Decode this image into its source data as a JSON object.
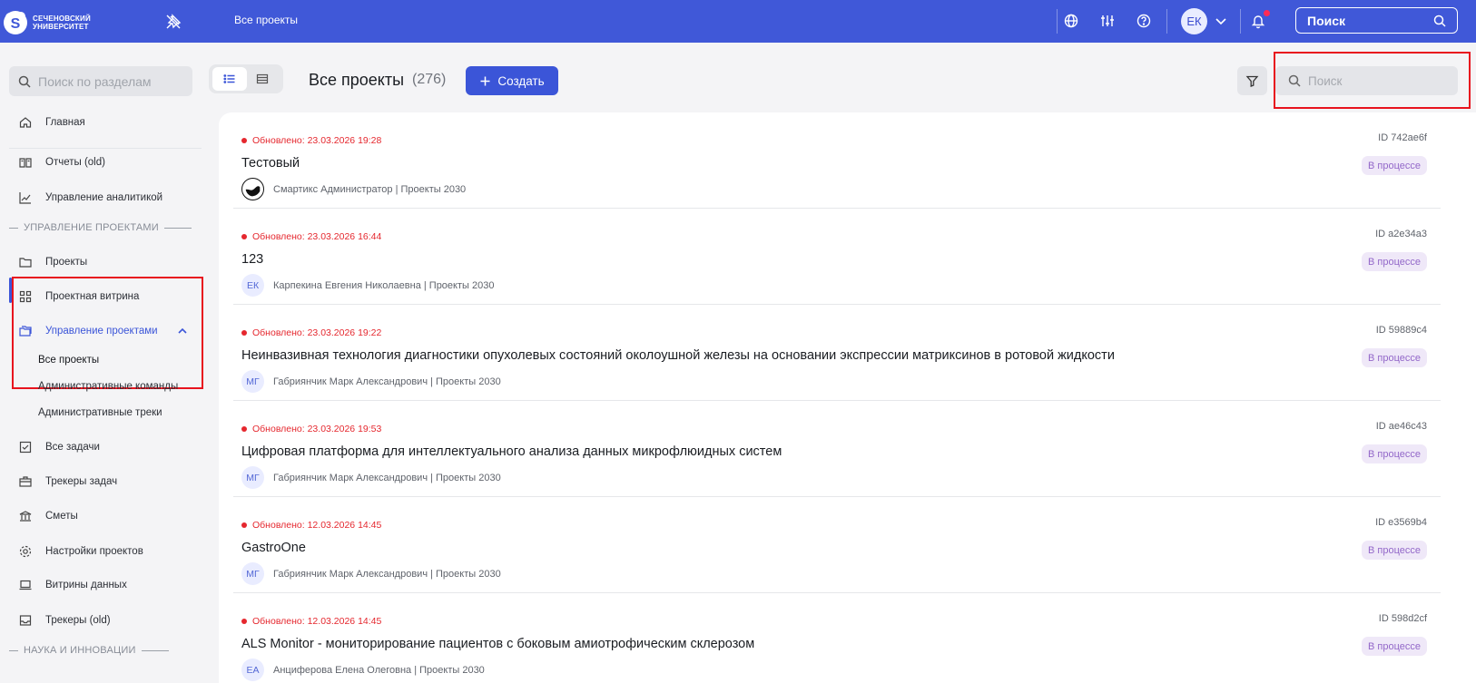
{
  "topbar": {
    "logo_line1": "СЕЧЕНОВСКИЙ",
    "logo_line2": "УНИВЕРСИТЕТ",
    "breadcrumb": "Все проекты",
    "avatar_initials": "ЕК",
    "search_label": "Поиск"
  },
  "sidebar": {
    "search_placeholder": "Поиск по разделам",
    "items": {
      "home": "Главная",
      "reports": "Отчеты (old)",
      "analytics": "Управление аналитикой",
      "section_projects": "УПРАВЛЕНИЕ ПРОЕКТАМИ",
      "projects": "Проекты",
      "showcase": "Проектная витрина",
      "project_mgmt": "Управление проектами",
      "sub_all": "Все проекты",
      "sub_teams": "Административные команды",
      "sub_tracks": "Административные треки",
      "tasks": "Все задачи",
      "trackers": "Трекеры задач",
      "estimates": "Сметы",
      "settings": "Настройки проектов",
      "data_showcase": "Витрины данных",
      "trackers_old": "Трекеры (old)",
      "section_science": "НАУКА И ИННОВАЦИИ"
    }
  },
  "header": {
    "title": "Все проекты",
    "count": "(276)",
    "create_label": "Создать",
    "search_placeholder": "Поиск"
  },
  "projects": [
    {
      "updated": "Обновлено: 23.03.2026 19:28",
      "name": "Тестовый",
      "owner": "Смартикс Администратор | Проекты 2030",
      "initials": "",
      "id": "ID 742ae6f",
      "status": "В процессе"
    },
    {
      "updated": "Обновлено: 23.03.2026 16:44",
      "name": "123",
      "owner": "Карпекина Евгения Николаевна | Проекты 2030",
      "initials": "ЕК",
      "id": "ID a2e34a3",
      "status": "В процессе"
    },
    {
      "updated": "Обновлено: 23.03.2026 19:22",
      "name": "Неинвазивная технология диагностики опухолевых состояний околоушной железы на основании экспрессии матриксинов в ротовой жидкости",
      "owner": "Габриянчик Марк Александрович | Проекты 2030",
      "initials": "МГ",
      "id": "ID 59889c4",
      "status": "В процессе"
    },
    {
      "updated": "Обновлено: 23.03.2026 19:53",
      "name": "Цифровая платформа для интеллектуального анализа данных микрофлюидных систем",
      "owner": "Габриянчик Марк Александрович | Проекты 2030",
      "initials": "МГ",
      "id": "ID ae46c43",
      "status": "В процессе"
    },
    {
      "updated": "Обновлено: 12.03.2026 14:45",
      "name": "GastroOne",
      "owner": "Габриянчик Марк Александрович | Проекты 2030",
      "initials": "МГ",
      "id": "ID e3569b4",
      "status": "В процессе"
    },
    {
      "updated": "Обновлено: 12.03.2026 14:45",
      "name": "ALS Monitor - мониторирование пациентов с боковым амиотрофическим склерозом",
      "owner": "Анциферова Елена Олеговна | Проекты 2030",
      "initials": "ЕА",
      "id": "ID 598d2cf",
      "status": "В процессе"
    }
  ]
}
